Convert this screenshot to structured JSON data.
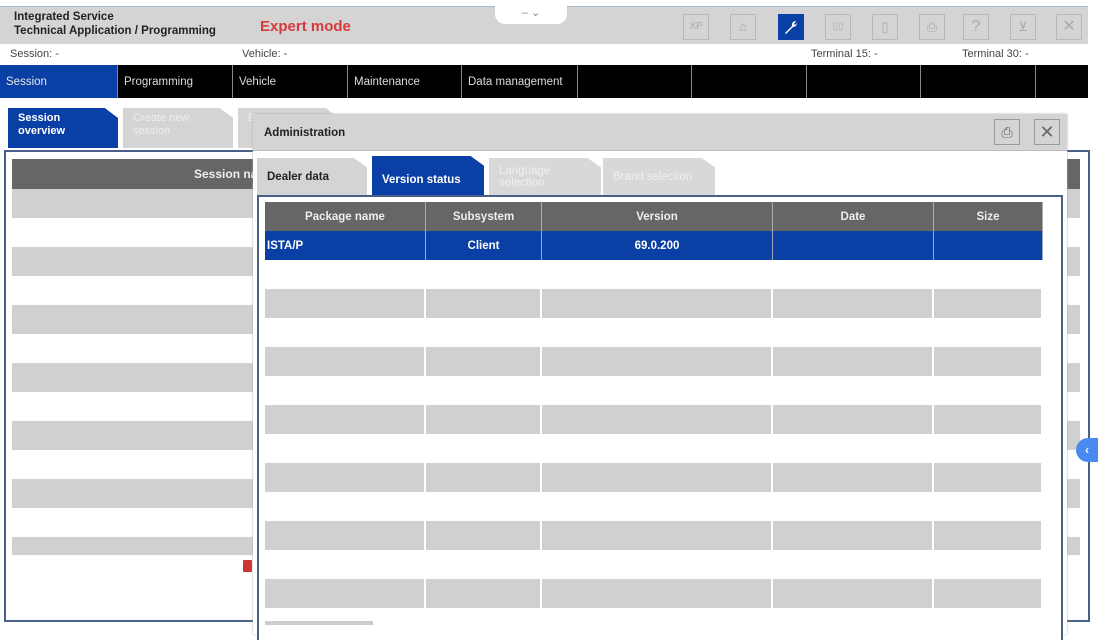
{
  "titlebar": {
    "app_title_line1": "Integrated Service",
    "app_title_line2": "Technical Application / Programming",
    "mode": "Expert mode",
    "window_controls": "– ⌄",
    "icons": [
      {
        "name": "xp-icon",
        "glyph": "XP"
      },
      {
        "name": "home-icon",
        "glyph": "⌂"
      },
      {
        "name": "wrench-icon",
        "glyph": "🔧"
      },
      {
        "name": "split-view-icon",
        "glyph": "▯▯"
      },
      {
        "name": "battery-icon",
        "glyph": "▯"
      },
      {
        "name": "print-icon",
        "glyph": "⎙"
      },
      {
        "name": "help-icon",
        "glyph": "?"
      },
      {
        "name": "minimize-window-icon",
        "glyph": "⊻"
      },
      {
        "name": "close-icon",
        "glyph": "✕"
      }
    ]
  },
  "infobar": {
    "session": "Session:  -",
    "vehicle": "Vehicle:  -",
    "terminal15": "Terminal 15:  -",
    "terminal30": "Terminal 30:  -"
  },
  "mainnav": {
    "items": [
      "Session",
      "Programming",
      "Vehicle",
      "Maintenance",
      "Data management",
      "",
      "",
      "",
      "",
      ""
    ]
  },
  "subtabs": {
    "session_overview": "Session overview",
    "create_new_session": "Create new session",
    "third": "E n"
  },
  "session_table": {
    "header": "Session name"
  },
  "dialog": {
    "title": "Administration",
    "print_icon": "⎙",
    "close_icon": "✕",
    "tabs": [
      "Dealer data",
      "Version status",
      "Language selection",
      "Brand selection"
    ],
    "table": {
      "columns": [
        "Package name",
        "Subsystem",
        "Version",
        "Date",
        "Size"
      ],
      "rows": [
        [
          "ISTA/P",
          "Client",
          "69.0.200",
          "",
          ""
        ]
      ]
    }
  },
  "side_handle": "‹"
}
